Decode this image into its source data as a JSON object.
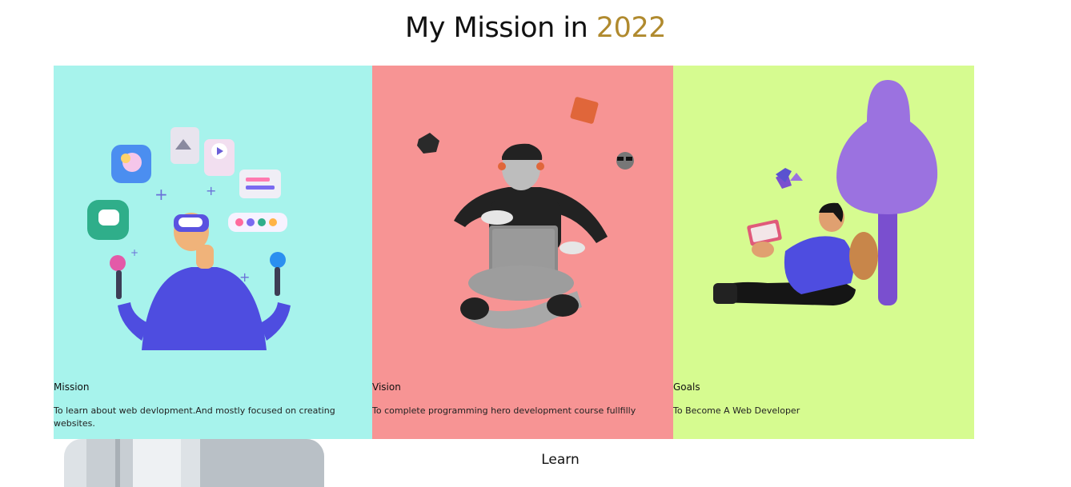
{
  "heading": {
    "text": "My Mission in ",
    "year": "2022"
  },
  "cards": [
    {
      "title": "Mission",
      "description": "To learn about web devlopment.And mostly focused on creating websites.",
      "bg": "#a7f3ec"
    },
    {
      "title": "Vision",
      "description": "To complete programming hero development course fullfilly",
      "bg": "#f79494"
    },
    {
      "title": "Goals",
      "description": "To Become A Web Developer",
      "bg": "#d6fb90"
    }
  ],
  "next_section": {
    "title": "Learn"
  },
  "colors": {
    "accent": "#b08a2e"
  }
}
